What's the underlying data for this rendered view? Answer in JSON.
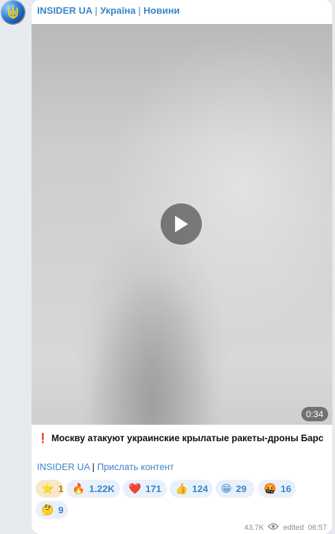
{
  "channel": {
    "name": "INSIDER UA",
    "separator": "|",
    "part2": "Україна",
    "part3": "Новини"
  },
  "video": {
    "duration": "0:34"
  },
  "post": {
    "headline": "Москву атакуют украинские крылатые ракеты-дроны Барс",
    "link1": "INSIDER UA",
    "pipe": "|",
    "link2": "Прислать контент"
  },
  "reactions": [
    {
      "emoji": "⭐",
      "count": "1"
    },
    {
      "emoji": "🔥",
      "count": "1.22K"
    },
    {
      "emoji": "❤️",
      "count": "171"
    },
    {
      "emoji": "👍",
      "count": "124"
    },
    {
      "emoji": "😁",
      "count": "29"
    },
    {
      "emoji": "🤬",
      "count": "16"
    },
    {
      "emoji": "🤔",
      "count": "9"
    }
  ],
  "meta": {
    "views": "43.7K",
    "edited": "edited",
    "time": "06:57"
  },
  "colors": {
    "accent": "#3b84c7",
    "bubble": "#ffffff",
    "background": "#e7ebf0"
  }
}
